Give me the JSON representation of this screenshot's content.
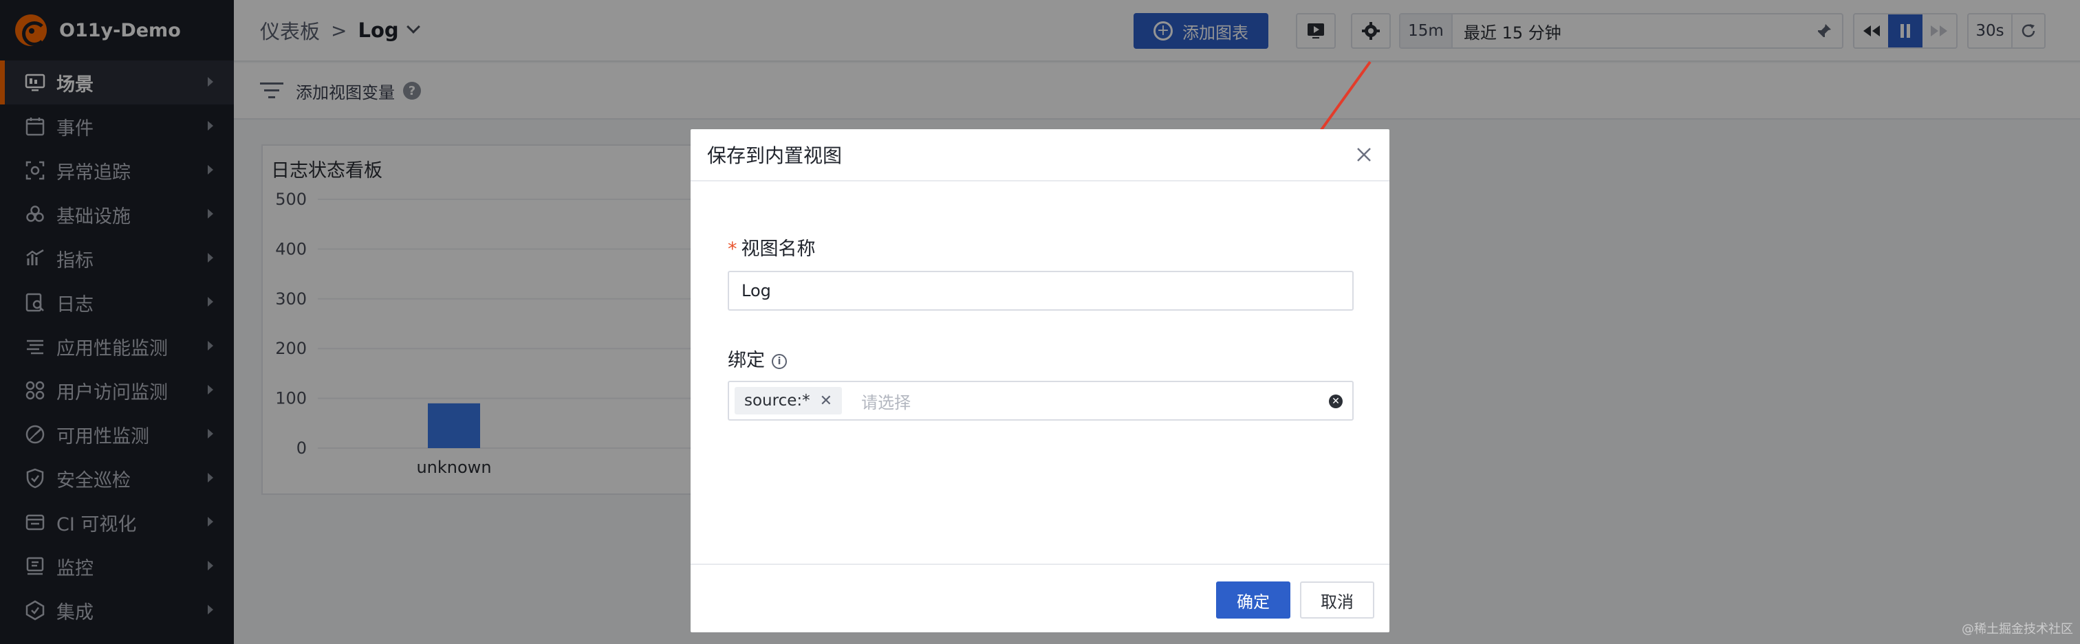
{
  "brand": {
    "name": "O11y-Demo"
  },
  "sidebar": {
    "items": [
      {
        "label": "场景",
        "icon": "monitor-icon",
        "active": true
      },
      {
        "label": "事件",
        "icon": "calendar-icon"
      },
      {
        "label": "异常追踪",
        "icon": "scan-icon"
      },
      {
        "label": "基础设施",
        "icon": "hexagons-icon"
      },
      {
        "label": "指标",
        "icon": "bar-chart-icon"
      },
      {
        "label": "日志",
        "icon": "log-search-icon"
      },
      {
        "label": "应用性能监测",
        "icon": "apm-lines-icon"
      },
      {
        "label": "用户访问监测",
        "icon": "grid-circles-icon"
      },
      {
        "label": "可用性监测",
        "icon": "gauge-icon"
      },
      {
        "label": "安全巡检",
        "icon": "shield-icon"
      },
      {
        "label": "CI 可视化",
        "icon": "ci-icon"
      },
      {
        "label": "监控",
        "icon": "monitor-alert-icon"
      },
      {
        "label": "集成",
        "icon": "integration-icon"
      }
    ]
  },
  "header": {
    "breadcrumb_parent": "仪表板",
    "breadcrumb_sep": ">",
    "breadcrumb_current": "Log",
    "add_chart_label": "添加图表",
    "time_short": "15m",
    "time_range": "最近 15 分钟",
    "refresh_interval": "30s"
  },
  "varbar": {
    "label": "添加视图变量",
    "help": "?"
  },
  "panel": {
    "title": "日志状态看板",
    "chart_data": {
      "type": "bar",
      "categories": [
        "unknown"
      ],
      "values": [
        90
      ],
      "title": "日志状态看板",
      "xlabel": "",
      "ylabel": "",
      "ylim": [
        0,
        500
      ],
      "yticks": [
        "500",
        "400",
        "300",
        "200",
        "100",
        "0"
      ],
      "grid": true,
      "color": "#3a78e6"
    }
  },
  "modal": {
    "title": "保存到内置视图",
    "name_label": "视图名称",
    "required_mark": "*",
    "name_value": "Log",
    "bind_label": "绑定",
    "info": "i",
    "tag_value": "source:*",
    "tag_remove": "✕",
    "select_placeholder": "请选择",
    "ok_label": "确定",
    "cancel_label": "取消"
  },
  "colors": {
    "accent": "#2d5fc9",
    "brand": "#ff6a00",
    "sidebar_bg": "#1d2029",
    "arrow": "#e33c2b"
  },
  "watermark": "@稀土掘金技术社区"
}
